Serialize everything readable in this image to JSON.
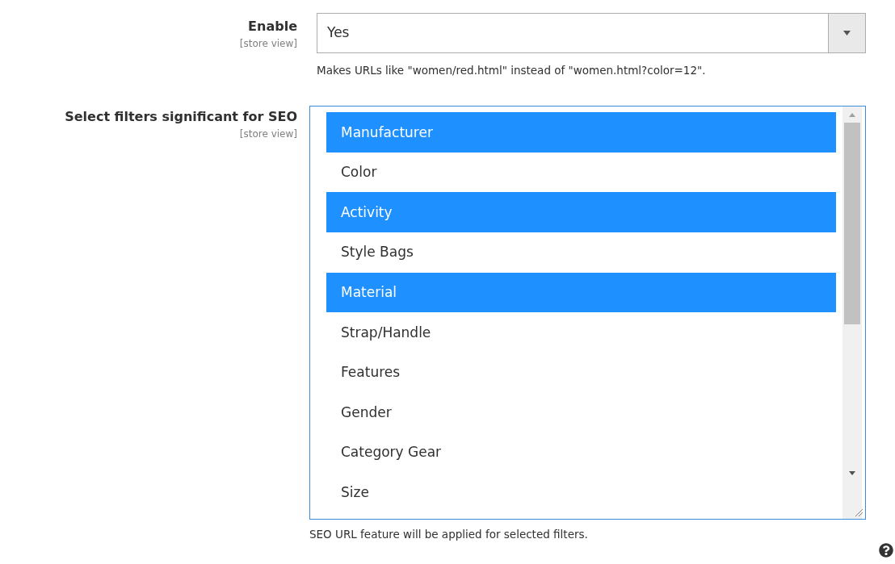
{
  "enable_field": {
    "label": "Enable",
    "scope": "[store view]",
    "value": "Yes",
    "note": "Makes URLs like \"women/red.html\" instead of \"women.html?color=12\"."
  },
  "filters_field": {
    "label": "Select filters significant for SEO",
    "scope": "[store view]",
    "note": "SEO URL feature will be applied for selected filters.",
    "options": [
      {
        "label": "Manufacturer",
        "selected": true
      },
      {
        "label": "Color",
        "selected": false
      },
      {
        "label": "Activity",
        "selected": true
      },
      {
        "label": "Style Bags",
        "selected": false
      },
      {
        "label": "Material",
        "selected": true
      },
      {
        "label": "Strap/Handle",
        "selected": false
      },
      {
        "label": "Features",
        "selected": false
      },
      {
        "label": "Gender",
        "selected": false
      },
      {
        "label": "Category Gear",
        "selected": false
      },
      {
        "label": "Size",
        "selected": false
      }
    ]
  }
}
